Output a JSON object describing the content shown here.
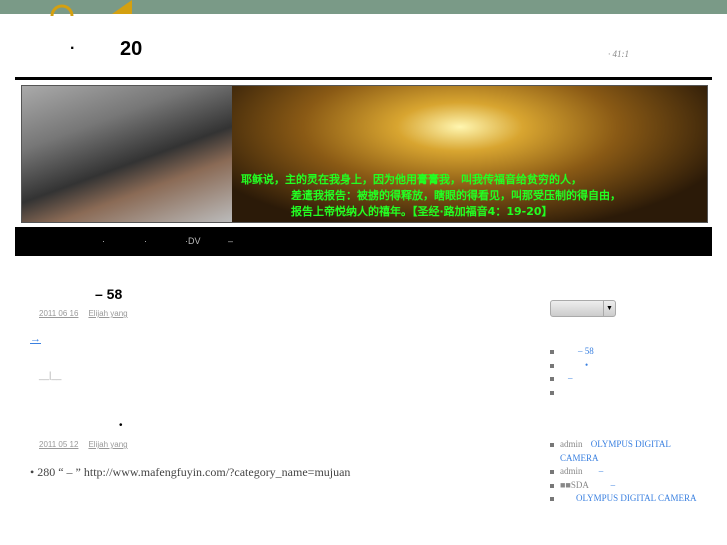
{
  "header": {
    "title_dot": "·",
    "title_num": "20",
    "verse_ref": "· 41:1"
  },
  "banner": {
    "quote": [
      "耶稣说，主的灵在我身上，因为他用膏膏我，叫我传福音给贫穷的人，",
      "差遣我报告：被掳的得释放，瞎眼的得看见，叫那受压制的得自由，",
      "报告上帝悦纳人的禧年。【圣经·路加福音4：19-20】"
    ]
  },
  "nav": {
    "items": [
      "·",
      "·",
      "·DV",
      "–"
    ]
  },
  "posts": [
    {
      "title": "–    58",
      "date": "2011  06  16",
      "author": "Elijah yang",
      "more": "→",
      "pager": "__|__"
    },
    {
      "title": "•",
      "date": "2011  05  12",
      "author": "Elijah yang",
      "body": "•                  280                “   –   ” http://www.mafengfuyin.com/?category_name=mujuan"
    }
  ],
  "sidebar": {
    "select_arrow": "▼",
    "recent": [
      "–  58",
      "•",
      "–",
      "",
      ""
    ],
    "comments": [
      {
        "who": "admin",
        "link": "OLYMPUS DIGITAL CAMERA"
      },
      {
        "who": "admin",
        "link": "–"
      },
      {
        "who": "■■SDA",
        "link": "–"
      },
      {
        "who": "",
        "link": "OLYMPUS DIGITAL CAMERA"
      }
    ]
  }
}
